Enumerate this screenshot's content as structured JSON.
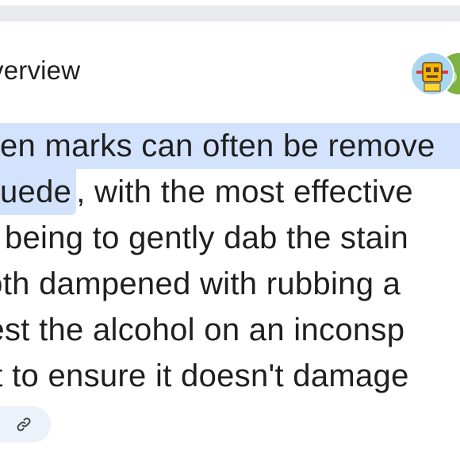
{
  "header": {
    "title": "verview"
  },
  "summary": {
    "line1": "en marks can often be remove",
    "line2_highlight": "uede",
    "line2_rest": ", with the most effective",
    "line3": "d being to gently dab the stain",
    "line4": "loth dampened with rubbing a",
    "line5": "test the alcohol on an inconsp",
    "line6": "st to ensure it doesn't damage"
  },
  "actions": {
    "link_icon": "link-icon"
  },
  "colors": {
    "highlight": "#d3e3fd",
    "text": "#1f1f1f",
    "chip": "#edf2fa",
    "top_bar": "#e9eaee"
  }
}
